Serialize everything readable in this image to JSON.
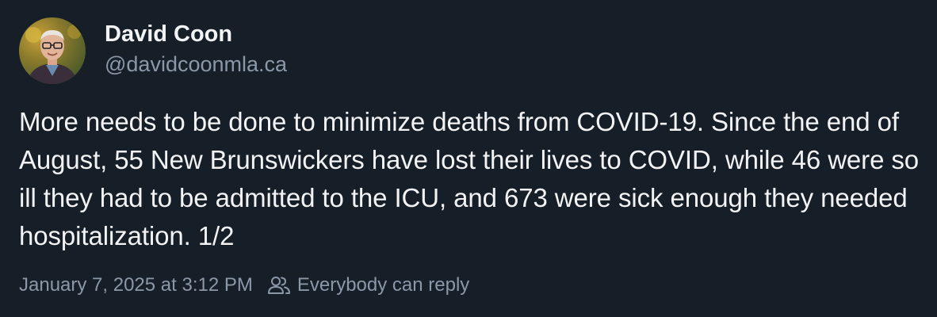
{
  "author": {
    "display_name": "David Coon",
    "handle": "@davidcoonmla.ca",
    "avatar_icon": "profile-photo"
  },
  "post": {
    "text": "More needs to be done to minimize deaths from COVID-19. Since the end of August, 55 New Brunswickers have lost their lives to COVID, while 46 were so ill they had to be admitted to the ICU, and 673 were sick enough they needed hospitalization. 1/2"
  },
  "meta": {
    "timestamp": "January 7, 2025 at 3:12 PM",
    "reply_setting": "Everybody can reply",
    "reply_icon": "people-icon"
  },
  "colors": {
    "background": "#161e27",
    "text_primary": "#f1f3f5",
    "text_secondary": "#8b98a8"
  }
}
